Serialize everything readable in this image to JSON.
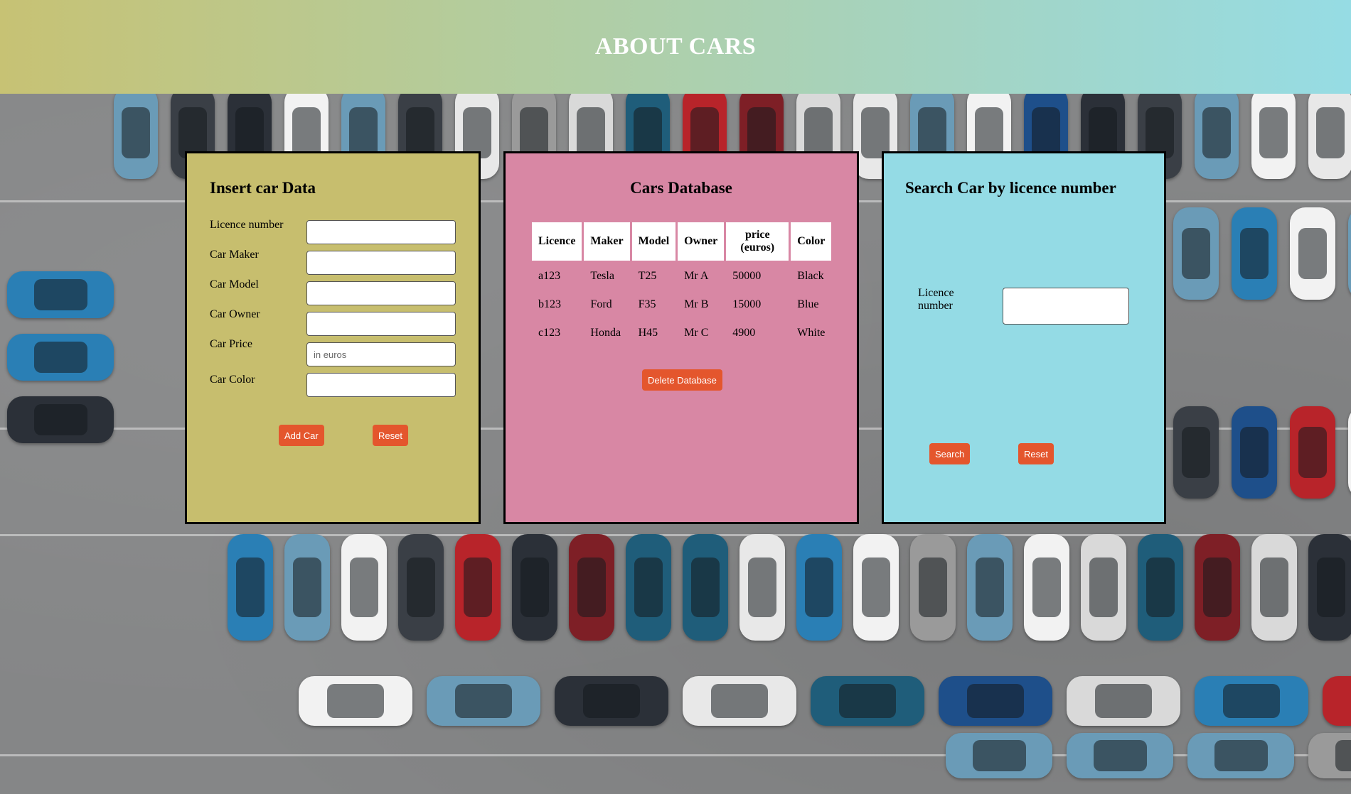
{
  "header": {
    "title": "ABOUT CARS"
  },
  "insert_panel": {
    "title": "Insert car Data",
    "fields": [
      {
        "label": "Licence number",
        "value": "",
        "placeholder": ""
      },
      {
        "label": "Car Maker",
        "value": "",
        "placeholder": ""
      },
      {
        "label": "Car Model",
        "value": "",
        "placeholder": ""
      },
      {
        "label": "Car Owner",
        "value": "",
        "placeholder": ""
      },
      {
        "label": "Car Price",
        "value": "",
        "placeholder": "in euros"
      },
      {
        "label": "Car Color",
        "value": "",
        "placeholder": ""
      }
    ],
    "add_button": "Add Car",
    "reset_button": "Reset"
  },
  "database_panel": {
    "title": "Cars Database",
    "columns": [
      "Licence",
      "Maker",
      "Model",
      "Owner",
      "price (euros)",
      "Color"
    ],
    "rows": [
      [
        "a123",
        "Tesla",
        "T25",
        "Mr A",
        "50000",
        "Black"
      ],
      [
        "b123",
        "Ford",
        "F35",
        "Mr B",
        "15000",
        "Blue"
      ],
      [
        "c123",
        "Honda",
        "H45",
        "Mr C",
        "4900",
        "White"
      ]
    ],
    "delete_button": "Delete Database"
  },
  "search_panel": {
    "title": "Search Car by licence number",
    "label": "Licence number",
    "value": "",
    "search_button": "Search",
    "reset_button": "Reset"
  },
  "colors": {
    "insert_panel": "#c7be6e",
    "database_panel": "#d887a4",
    "search_panel": "#94dbe5",
    "button": "#e4562d"
  }
}
